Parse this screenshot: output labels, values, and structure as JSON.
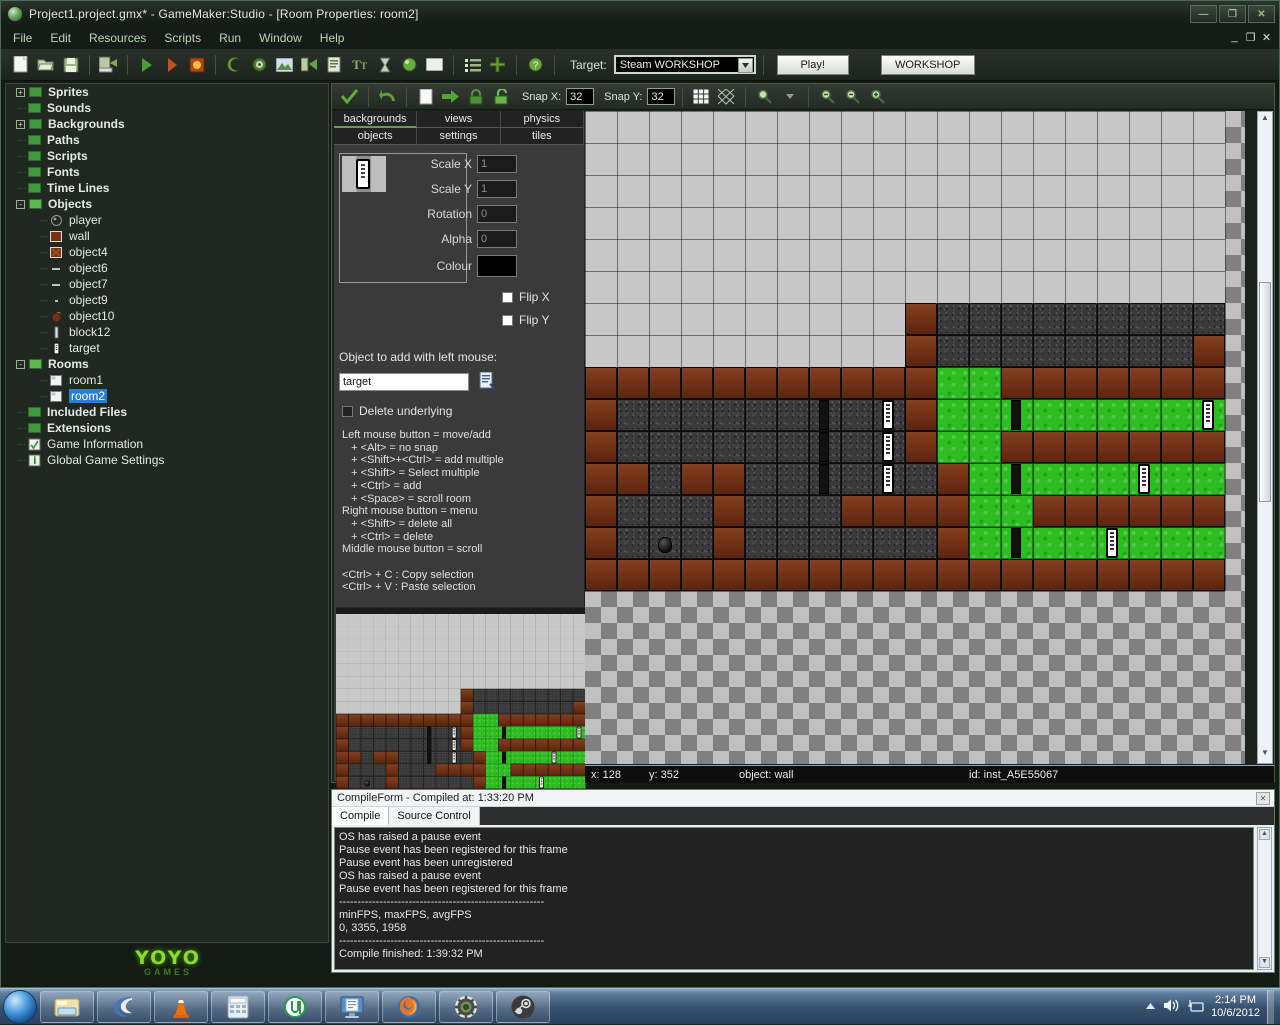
{
  "window": {
    "title": "Project1.project.gmx* - GameMaker:Studio  - [Room Properties: room2]",
    "app_icon": "gamemaker-icon",
    "buttons": {
      "minimize": "—",
      "maximize": "❐",
      "close": "✕"
    },
    "mdi_buttons": {
      "minimize": "_",
      "restore": "❐",
      "close": "✕"
    }
  },
  "menubar": {
    "items": [
      {
        "label": "File"
      },
      {
        "label": "Edit"
      },
      {
        "label": "Resources"
      },
      {
        "label": "Scripts"
      },
      {
        "label": "Run"
      },
      {
        "label": "Window"
      },
      {
        "label": "Help"
      }
    ]
  },
  "toolbar": {
    "icons": [
      "new-file-icon",
      "open-folder-icon",
      "save-icon",
      "create-executable-icon",
      "run-icon",
      "debug-run-icon",
      "stop-icon",
      "sprite-icon",
      "sound-icon",
      "background-icon",
      "path-icon",
      "script-icon",
      "font-icon",
      "timeline-icon",
      "object-icon",
      "room-icon",
      "included-files-icon",
      "extension-icon",
      "help-icon"
    ],
    "target_label": "Target:",
    "target_value": "Steam WORKSHOP",
    "play_label": "Play!",
    "workshop_label": "WORKSHOP"
  },
  "tree": {
    "items": [
      {
        "label": "Sprites",
        "type": "folder",
        "bold": true,
        "expander": "+",
        "indent": 0
      },
      {
        "label": "Sounds",
        "type": "folder",
        "bold": true,
        "expander": "",
        "indent": 0
      },
      {
        "label": "Backgrounds",
        "type": "folder",
        "bold": true,
        "expander": "+",
        "indent": 0
      },
      {
        "label": "Paths",
        "type": "folder",
        "bold": true,
        "expander": "",
        "indent": 0
      },
      {
        "label": "Scripts",
        "type": "folder",
        "bold": true,
        "expander": "",
        "indent": 0
      },
      {
        "label": "Fonts",
        "type": "folder",
        "bold": true,
        "expander": "",
        "indent": 0
      },
      {
        "label": "Time Lines",
        "type": "folder",
        "bold": true,
        "expander": "",
        "indent": 0
      },
      {
        "label": "Objects",
        "type": "folder-open",
        "bold": true,
        "expander": "-",
        "indent": 0
      },
      {
        "label": "player",
        "type": "object-ball",
        "bold": false,
        "expander": "",
        "indent": 1
      },
      {
        "label": "wall",
        "type": "object-brick",
        "bold": false,
        "expander": "",
        "indent": 1
      },
      {
        "label": "object4",
        "type": "object-brickx",
        "bold": false,
        "expander": "",
        "indent": 1
      },
      {
        "label": "object6",
        "type": "object-dash",
        "bold": false,
        "expander": "",
        "indent": 1
      },
      {
        "label": "object7",
        "type": "object-dash",
        "bold": false,
        "expander": "",
        "indent": 1
      },
      {
        "label": "object9",
        "type": "object-dot",
        "bold": false,
        "expander": "",
        "indent": 1
      },
      {
        "label": "object10",
        "type": "object-bomb",
        "bold": false,
        "expander": "",
        "indent": 1
      },
      {
        "label": "block12",
        "type": "object-bar",
        "bold": false,
        "expander": "",
        "indent": 1
      },
      {
        "label": "target",
        "type": "object-target",
        "bold": false,
        "expander": "",
        "indent": 1
      },
      {
        "label": "Rooms",
        "type": "folder-open",
        "bold": true,
        "expander": "-",
        "indent": 0
      },
      {
        "label": "room1",
        "type": "room",
        "bold": false,
        "expander": "",
        "indent": 1
      },
      {
        "label": "room2",
        "type": "room",
        "bold": false,
        "expander": "",
        "indent": 1,
        "selected": true
      },
      {
        "label": "Included Files",
        "type": "folder",
        "bold": true,
        "expander": "",
        "indent": 0
      },
      {
        "label": "Extensions",
        "type": "folder",
        "bold": true,
        "expander": "",
        "indent": 0
      },
      {
        "label": "Game Information",
        "type": "gameinfo",
        "bold": false,
        "expander": "",
        "indent": 0
      },
      {
        "label": "Global Game Settings",
        "type": "settings",
        "bold": false,
        "expander": "",
        "indent": 0
      }
    ]
  },
  "branding": {
    "line1": "YOYO",
    "line2": "GAMES"
  },
  "room_toolbar": {
    "icons": [
      "ok-check-icon",
      "undo-icon",
      "new-room-icon",
      "next-icon",
      "lock-icon",
      "unlock-icon",
      "grid-toggle-icon",
      "isometric-grid-icon",
      "zoom-icon",
      "zoom-dropdown-icon",
      "zoom-out-icon",
      "zoom-reset-icon",
      "zoom-in-icon"
    ],
    "snap_x_label": "Snap X:",
    "snap_x_value": "32",
    "snap_y_label": "Snap Y:",
    "snap_y_value": "32"
  },
  "properties": {
    "tabs_top": [
      {
        "label": "backgrounds",
        "active": true
      },
      {
        "label": "views",
        "active": false
      },
      {
        "label": "physics",
        "active": false
      }
    ],
    "tabs_bottom": [
      {
        "label": "objects",
        "active": true
      },
      {
        "label": "settings",
        "active": false
      },
      {
        "label": "tiles",
        "active": false
      }
    ],
    "fields": [
      {
        "label": "Scale X",
        "value": "1"
      },
      {
        "label": "Scale Y",
        "value": "1"
      },
      {
        "label": "Rotation",
        "value": "0"
      },
      {
        "label": "Alpha",
        "value": "0"
      }
    ],
    "colour_label": "Colour",
    "colour_value": "#000000",
    "flip_x_label": "Flip X",
    "flip_y_label": "Flip Y",
    "flip_x_checked": false,
    "flip_y_checked": false,
    "object_to_add_label": "Object to add with left mouse:",
    "object_to_add_value": "target",
    "object_menu_icon": "object-list-icon",
    "delete_underlying_label": "Delete underlying",
    "delete_underlying_checked": false,
    "help_text": "Left mouse button = move/add\n   + <Alt> = no snap\n   + <Shift>+<Ctrl> = add multiple\n   + <Shift> = Select multiple\n   + <Ctrl> = add\n   + <Space> = scroll room\nRight mouse button = menu\n   + <Shift> = delete all\n   + <Ctrl> = delete\nMiddle mouse button = scroll\n\n<Ctrl> + C : Copy selection\n<Ctrl> + V : Paste selection"
  },
  "status": {
    "x_label": "x: 128",
    "y_label": "y: 352",
    "object_label": "object: wall",
    "id_label": "id: inst_A5E55067"
  },
  "compile": {
    "caption": "CompileForm - Compiled at: 1:33:20 PM",
    "close_icon": "close-icon",
    "tabs": [
      {
        "label": "Compile",
        "active": true
      },
      {
        "label": "Source Control",
        "active": false
      }
    ],
    "log": "OS has raised a pause event\nPause event has been registered for this frame\nPause event has been unregistered\nOS has raised a pause event\nPause event has been registered for this frame\n--------------------------------------------------------\nminFPS, maxFPS, avgFPS\n0, 3355, 1958\n--------------------------------------------------------\nCompile finished: 1:39:32 PM"
  },
  "taskbar": {
    "start_icon": "windows-start-icon",
    "items": [
      {
        "icon": "explorer-icon"
      },
      {
        "icon": "clover-browser-icon"
      },
      {
        "icon": "vlc-cone-icon"
      },
      {
        "icon": "calculator-icon"
      },
      {
        "icon": "utorrent-icon"
      },
      {
        "icon": "notepad-icon"
      },
      {
        "icon": "firefox-icon"
      },
      {
        "icon": "gamemaker-icon"
      },
      {
        "icon": "steam-icon"
      }
    ],
    "tray": {
      "show_hidden_icon": "chevron-up-icon",
      "volume_icon": "speaker-icon",
      "network_icon": "network-icon",
      "time": "2:14 PM",
      "date": "10/6/2012"
    }
  },
  "room": {
    "cell_size": 32,
    "cols": 20,
    "rows": 15,
    "colors": {
      "brick": "#7a3110",
      "stone": "#3a3a3a",
      "grass": "#2dbe21",
      "empty": "#c8c8c8"
    },
    "tiles": [
      "....................",
      "....................",
      "....................",
      "....................",
      "....................",
      "....................",
      "..........bsssssssssb",
      "..........bssssssssb",
      "bbbbbbbbbbbggbbbbbbb",
      "bsssssssssbggkgggggg",
      "bsssssssssbggbbbbbbb",
      "bbsbbssssssbggkggggg",
      "bsssbsssbbbbggbbbbbb",
      "bsssbssssssbggkggggg",
      "bbbbbbbbbbbbbbbbbbbb"
    ],
    "instances": [
      {
        "type": "block12",
        "col": 7,
        "row": 9
      },
      {
        "type": "block12",
        "col": 7,
        "row": 10
      },
      {
        "type": "block12",
        "col": 7,
        "row": 11
      },
      {
        "type": "block12",
        "col": 13,
        "row": 9
      },
      {
        "type": "block12",
        "col": 13,
        "row": 11
      },
      {
        "type": "block12",
        "col": 13,
        "row": 13
      },
      {
        "type": "target",
        "col": 9,
        "row": 9
      },
      {
        "type": "target",
        "col": 9,
        "row": 10
      },
      {
        "type": "target",
        "col": 9,
        "row": 11
      },
      {
        "type": "target",
        "col": 19,
        "row": 9
      },
      {
        "type": "target",
        "col": 17,
        "row": 11
      },
      {
        "type": "target",
        "col": 16,
        "row": 13
      },
      {
        "type": "player",
        "col": 2,
        "row": 13
      }
    ]
  }
}
